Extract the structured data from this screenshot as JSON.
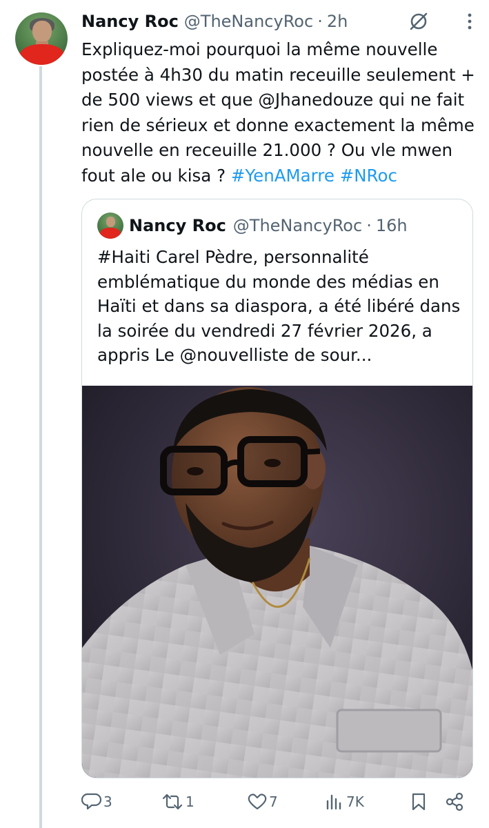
{
  "tweet": {
    "author_name": "Nancy Roc",
    "author_handle": "@TheNancyRoc",
    "separator": "·",
    "time": "2h",
    "text_plain": "Expliquez-moi pourquoi la même nouvelle postée à 4h30 du matin receuille seulement + de 500 views et que @Jhanedouze qui ne fait rien de sérieux et donne exactement la même nouvelle en receuille 21.000 ? Ou vle mwen fout ale ou kisa ? ",
    "hashtag_1": "#YenAMarre",
    "hashtag_2": "#NRoc"
  },
  "quoted_tweet": {
    "author_name": "Nancy Roc",
    "author_handle": "@TheNancyRoc",
    "separator": "·",
    "time": "16h",
    "text": "#Haiti Carel Pèdre, personnalité emblématique du monde des médias en Haïti et dans sa diaspora, a été libéré dans la soirée du vendredi 27 février 2026, a appris Le @nouvelliste  de sour..."
  },
  "actions": {
    "replies": "3",
    "reposts": "1",
    "likes": "7",
    "views": "7K"
  },
  "icons": {
    "grok": "grok-icon",
    "more": "more-dots-icon",
    "reply": "reply-icon",
    "repost": "repost-icon",
    "like": "heart-icon",
    "views": "views-chart-icon",
    "bookmark": "bookmark-icon",
    "share": "share-icon"
  },
  "colors": {
    "text": "#0f1419",
    "secondary": "#536471",
    "link": "#1d9bf0",
    "border": "#cfd9de"
  }
}
